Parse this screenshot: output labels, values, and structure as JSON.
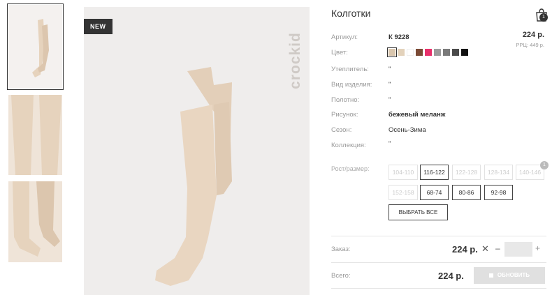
{
  "product": {
    "title": "Колготки",
    "badge": "NEW",
    "brand": "crockid",
    "cart_count": "1"
  },
  "details": {
    "sku_label": "Артикул:",
    "sku_value": "К 9228",
    "price": "224 р.",
    "rrc": "РРЦ: 449 р.",
    "color_label": "Цвет:",
    "insulation_label": "Утеплитель:",
    "insulation_value": "\"",
    "type_label": "Вид изделия:",
    "type_value": "\"",
    "fabric_label": "Полотно:",
    "fabric_value": "\"",
    "pattern_label": "Рисунок:",
    "pattern_value": "бежевый меланж",
    "season_label": "Сезон:",
    "season_value": "Осень-Зима",
    "collection_label": "Коллекция:",
    "collection_value": "\""
  },
  "swatches": [
    "#d9c6ad",
    "#e3d2bb",
    "#ffffff",
    "#7a4a35",
    "#e8306b",
    "#9c9c9c",
    "#7a7a7a",
    "#4a4a4a",
    "#111111"
  ],
  "sizes": {
    "label": "Рост/размер:",
    "badge": "1",
    "select_all": "ВЫБРАТЬ ВСЕ",
    "items": [
      {
        "label": "104-110",
        "available": false
      },
      {
        "label": "116-122",
        "available": true
      },
      {
        "label": "122-128",
        "available": false
      },
      {
        "label": "128-134",
        "available": false
      },
      {
        "label": "140-146",
        "available": false
      },
      {
        "label": "152-158",
        "available": false
      },
      {
        "label": "68-74",
        "available": true
      },
      {
        "label": "80-86",
        "available": true
      },
      {
        "label": "92-98",
        "available": true
      }
    ]
  },
  "order": {
    "label": "Заказ:",
    "price": "224 р.",
    "remove": "✕",
    "minus": "–",
    "plus": "+",
    "quantity": ""
  },
  "total": {
    "label": "Всего:",
    "price": "224 р.",
    "button": "ОБНОВИТЬ"
  },
  "colors": {
    "accent": "#333333",
    "muted": "#999999",
    "button_disabled": "#e0e0e0",
    "tights": "#e9d6c1"
  }
}
